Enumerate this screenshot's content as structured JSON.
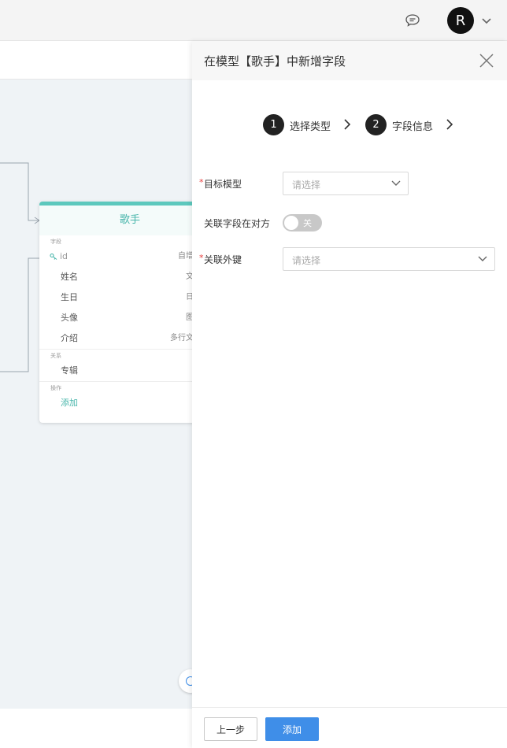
{
  "header": {
    "avatar_initial": "R",
    "chat_icon": "chat-bubble-icon",
    "avatar_caret_icon": "chevron-down-icon"
  },
  "model_card": {
    "title": "歌手",
    "fields_section_label": "字段",
    "fields": [
      {
        "name": "id",
        "type": "自增",
        "icon": "key-icon"
      },
      {
        "name": "姓名",
        "type": "文"
      },
      {
        "name": "生日",
        "type": "日"
      },
      {
        "name": "头像",
        "type": "图"
      },
      {
        "name": "介绍",
        "type": "多行文"
      }
    ],
    "relations_section_label": "关系",
    "relations": [
      {
        "name": "专辑"
      }
    ],
    "actions_section_label": "操作",
    "add_action": "添加"
  },
  "drawer": {
    "title": "在模型【歌手】中新增字段",
    "steps": [
      {
        "number": "1",
        "label": "选择类型"
      },
      {
        "number": "2",
        "label": "字段信息"
      }
    ],
    "form": {
      "target_model": {
        "label": "目标模型",
        "required": true,
        "placeholder": "请选择"
      },
      "relation_on_other_side": {
        "label": "关联字段在对方",
        "toggle_text": "关",
        "value": false
      },
      "foreign_key": {
        "label": "关联外键",
        "required": true,
        "placeholder": "请选择"
      }
    },
    "footer": {
      "prev_label": "上一步",
      "add_label": "添加"
    }
  },
  "colors": {
    "accent": "#3f8ee8",
    "card_accent": "#5cc8bd",
    "required": "#e63c3c"
  }
}
